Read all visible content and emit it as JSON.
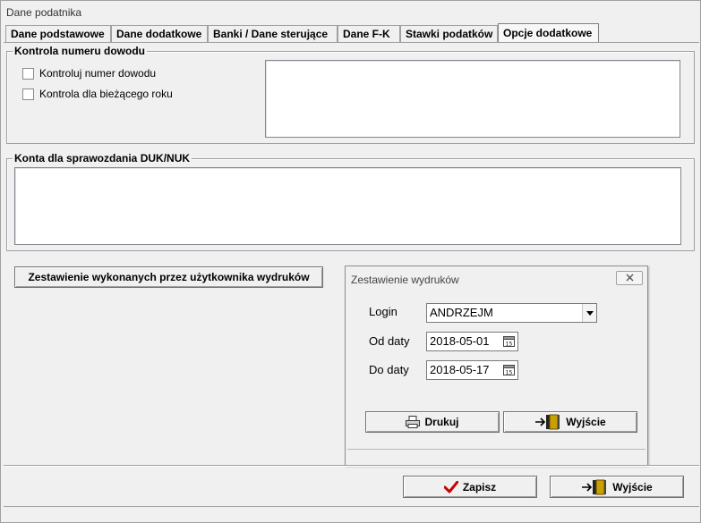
{
  "window": {
    "title": "Dane podatnika"
  },
  "tabs": [
    {
      "label": "Dane podstawowe",
      "active": false
    },
    {
      "label": "Dane dodatkowe",
      "active": false
    },
    {
      "label": "Banki / Dane sterujące",
      "active": false
    },
    {
      "label": "Dane F-K",
      "active": false
    },
    {
      "label": "Stawki podatków",
      "active": false
    },
    {
      "label": "Opcje dodatkowe",
      "active": true
    }
  ],
  "kontrola": {
    "legend": "Kontrola numeru dowodu",
    "check1": {
      "label": "Kontroluj numer dowodu",
      "checked": false
    },
    "check2": {
      "label": "Kontrola dla bieżącego roku",
      "checked": false
    }
  },
  "konta": {
    "legend": "Konta dla sprawozdania DUK/NUK"
  },
  "report_button": {
    "label": "Zestawienie wykonanych przez użytkownika wydruków"
  },
  "dialog": {
    "title": "Zestawienie wydruków",
    "login_label": "Login",
    "login_value": "ANDRZEJM",
    "od_label": "Od daty",
    "od_value": "2018-05-01",
    "do_label": "Do daty",
    "do_value": "2018-05-17",
    "print_label": "Drukuj",
    "exit_label": "Wyjście"
  },
  "footer": {
    "save_label": "Zapisz",
    "exit_label": "Wyjście"
  },
  "colors": {
    "accent_check": "#cc0000",
    "door": "#c8a000"
  },
  "icons": [
    "close-icon",
    "chevron-down-icon",
    "calendar-icon",
    "printer-icon",
    "exit-door-icon",
    "checkmark-icon"
  ]
}
